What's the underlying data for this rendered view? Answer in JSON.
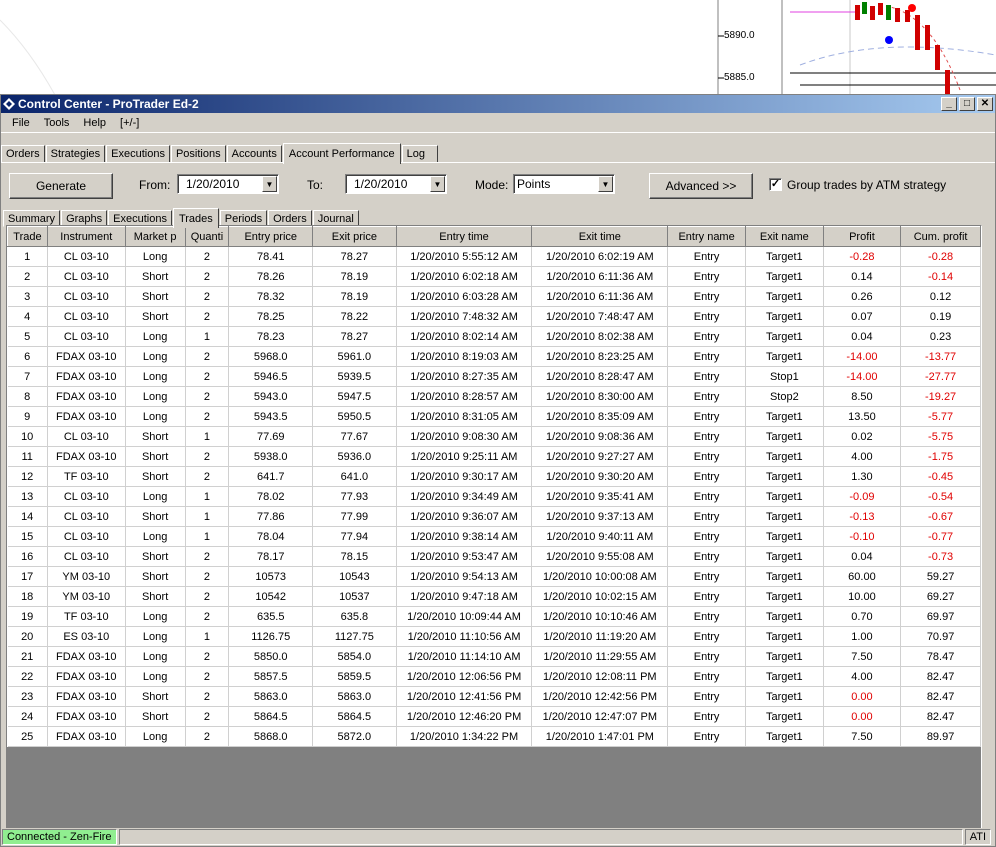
{
  "background_chart": {
    "price_labels": [
      "5890.0",
      "5885.0"
    ]
  },
  "window": {
    "title": "Control Center - ProTrader Ed-2",
    "buttons": [
      "_",
      "□",
      "✕"
    ]
  },
  "menu": [
    "File",
    "Tools",
    "Help",
    "[+/-]"
  ],
  "top_tabs": [
    "Orders",
    "Strategies",
    "Executions",
    "Positions",
    "Accounts",
    "Account Performance",
    "Log"
  ],
  "active_top_tab": "Account Performance",
  "controls": {
    "generate_label": "Generate",
    "from_label": "From:",
    "from_value": "1/20/2010",
    "to_label": "To:",
    "to_value": "1/20/2010",
    "mode_label": "Mode:",
    "mode_value": "Points",
    "advanced_label": "Advanced >>",
    "group_checkbox_label": "Group trades by ATM strategy",
    "group_checked": true
  },
  "sub_tabs": [
    "Summary",
    "Graphs",
    "Executions",
    "Trades",
    "Periods",
    "Orders",
    "Journal"
  ],
  "active_sub_tab": "Trades",
  "table": {
    "columns": [
      "Trade",
      "Instrument",
      "Market p",
      "Quanti",
      "Entry price",
      "Exit price",
      "Entry time",
      "Exit time",
      "Entry name",
      "Exit name",
      "Profit",
      "Cum. profit"
    ],
    "rows": [
      [
        "1",
        "CL 03-10",
        "Long",
        "2",
        "78.41",
        "78.27",
        "1/20/2010 5:55:12 AM",
        "1/20/2010 6:02:19 AM",
        "Entry",
        "Target1",
        "-0.28",
        "-0.28"
      ],
      [
        "2",
        "CL 03-10",
        "Short",
        "2",
        "78.26",
        "78.19",
        "1/20/2010 6:02:18 AM",
        "1/20/2010 6:11:36 AM",
        "Entry",
        "Target1",
        "0.14",
        "-0.14"
      ],
      [
        "3",
        "CL 03-10",
        "Short",
        "2",
        "78.32",
        "78.19",
        "1/20/2010 6:03:28 AM",
        "1/20/2010 6:11:36 AM",
        "Entry",
        "Target1",
        "0.26",
        "0.12"
      ],
      [
        "4",
        "CL 03-10",
        "Short",
        "2",
        "78.25",
        "78.22",
        "1/20/2010 7:48:32 AM",
        "1/20/2010 7:48:47 AM",
        "Entry",
        "Target1",
        "0.07",
        "0.19"
      ],
      [
        "5",
        "CL 03-10",
        "Long",
        "1",
        "78.23",
        "78.27",
        "1/20/2010 8:02:14 AM",
        "1/20/2010 8:02:38 AM",
        "Entry",
        "Target1",
        "0.04",
        "0.23"
      ],
      [
        "6",
        "FDAX 03-10",
        "Long",
        "2",
        "5968.0",
        "5961.0",
        "1/20/2010 8:19:03 AM",
        "1/20/2010 8:23:25 AM",
        "Entry",
        "Target1",
        "-14.00",
        "-13.77"
      ],
      [
        "7",
        "FDAX 03-10",
        "Long",
        "2",
        "5946.5",
        "5939.5",
        "1/20/2010 8:27:35 AM",
        "1/20/2010 8:28:47 AM",
        "Entry",
        "Stop1",
        "-14.00",
        "-27.77"
      ],
      [
        "8",
        "FDAX 03-10",
        "Long",
        "2",
        "5943.0",
        "5947.5",
        "1/20/2010 8:28:57 AM",
        "1/20/2010 8:30:00 AM",
        "Entry",
        "Stop2",
        "8.50",
        "-19.27"
      ],
      [
        "9",
        "FDAX 03-10",
        "Long",
        "2",
        "5943.5",
        "5950.5",
        "1/20/2010 8:31:05 AM",
        "1/20/2010 8:35:09 AM",
        "Entry",
        "Target1",
        "13.50",
        "-5.77"
      ],
      [
        "10",
        "CL 03-10",
        "Short",
        "1",
        "77.69",
        "77.67",
        "1/20/2010 9:08:30 AM",
        "1/20/2010 9:08:36 AM",
        "Entry",
        "Target1",
        "0.02",
        "-5.75"
      ],
      [
        "11",
        "FDAX 03-10",
        "Short",
        "2",
        "5938.0",
        "5936.0",
        "1/20/2010 9:25:11 AM",
        "1/20/2010 9:27:27 AM",
        "Entry",
        "Target1",
        "4.00",
        "-1.75"
      ],
      [
        "12",
        "TF 03-10",
        "Short",
        "2",
        "641.7",
        "641.0",
        "1/20/2010 9:30:17 AM",
        "1/20/2010 9:30:20 AM",
        "Entry",
        "Target1",
        "1.30",
        "-0.45"
      ],
      [
        "13",
        "CL 03-10",
        "Long",
        "1",
        "78.02",
        "77.93",
        "1/20/2010 9:34:49 AM",
        "1/20/2010 9:35:41 AM",
        "Entry",
        "Target1",
        "-0.09",
        "-0.54"
      ],
      [
        "14",
        "CL 03-10",
        "Short",
        "1",
        "77.86",
        "77.99",
        "1/20/2010 9:36:07 AM",
        "1/20/2010 9:37:13 AM",
        "Entry",
        "Target1",
        "-0.13",
        "-0.67"
      ],
      [
        "15",
        "CL 03-10",
        "Long",
        "1",
        "78.04",
        "77.94",
        "1/20/2010 9:38:14 AM",
        "1/20/2010 9:40:11 AM",
        "Entry",
        "Target1",
        "-0.10",
        "-0.77"
      ],
      [
        "16",
        "CL 03-10",
        "Short",
        "2",
        "78.17",
        "78.15",
        "1/20/2010 9:53:47 AM",
        "1/20/2010 9:55:08 AM",
        "Entry",
        "Target1",
        "0.04",
        "-0.73"
      ],
      [
        "17",
        "YM 03-10",
        "Short",
        "2",
        "10573",
        "10543",
        "1/20/2010 9:54:13 AM",
        "1/20/2010 10:00:08 AM",
        "Entry",
        "Target1",
        "60.00",
        "59.27"
      ],
      [
        "18",
        "YM 03-10",
        "Short",
        "2",
        "10542",
        "10537",
        "1/20/2010 9:47:18 AM",
        "1/20/2010 10:02:15 AM",
        "Entry",
        "Target1",
        "10.00",
        "69.27"
      ],
      [
        "19",
        "TF 03-10",
        "Long",
        "2",
        "635.5",
        "635.8",
        "1/20/2010 10:09:44 AM",
        "1/20/2010 10:10:46 AM",
        "Entry",
        "Target1",
        "0.70",
        "69.97"
      ],
      [
        "20",
        "ES 03-10",
        "Long",
        "1",
        "1126.75",
        "1127.75",
        "1/20/2010 11:10:56 AM",
        "1/20/2010 11:19:20 AM",
        "Entry",
        "Target1",
        "1.00",
        "70.97"
      ],
      [
        "21",
        "FDAX 03-10",
        "Long",
        "2",
        "5850.0",
        "5854.0",
        "1/20/2010 11:14:10 AM",
        "1/20/2010 11:29:55 AM",
        "Entry",
        "Target1",
        "7.50",
        "78.47"
      ],
      [
        "22",
        "FDAX 03-10",
        "Long",
        "2",
        "5857.5",
        "5859.5",
        "1/20/2010 12:06:56 PM",
        "1/20/2010 12:08:11 PM",
        "Entry",
        "Target1",
        "4.00",
        "82.47"
      ],
      [
        "23",
        "FDAX 03-10",
        "Short",
        "2",
        "5863.0",
        "5863.0",
        "1/20/2010 12:41:56 PM",
        "1/20/2010 12:42:56 PM",
        "Entry",
        "Target1",
        "0.00",
        "82.47"
      ],
      [
        "24",
        "FDAX 03-10",
        "Short",
        "2",
        "5864.5",
        "5864.5",
        "1/20/2010 12:46:20 PM",
        "1/20/2010 12:47:07 PM",
        "Entry",
        "Target1",
        "0.00",
        "82.47"
      ],
      [
        "25",
        "FDAX 03-10",
        "Long",
        "2",
        "5868.0",
        "5872.0",
        "1/20/2010 1:34:22 PM",
        "1/20/2010 1:47:01 PM",
        "Entry",
        "Target1",
        "7.50",
        "89.97"
      ]
    ],
    "red_profit_rows": [
      1,
      6,
      7,
      13,
      14,
      15,
      23,
      24
    ]
  },
  "status": {
    "connection": "Connected - Zen-Fire",
    "right": "ATI"
  },
  "colors": {
    "negative": "#e00000",
    "connected_bg": "#90ee90",
    "title_start": "#0a246a",
    "title_end": "#a6caf0"
  }
}
